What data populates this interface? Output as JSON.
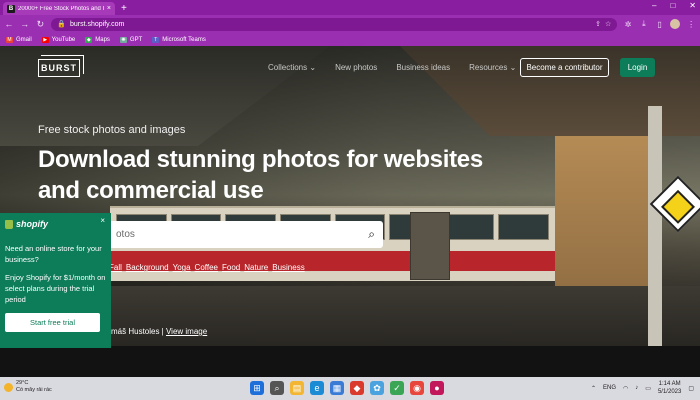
{
  "browser": {
    "tab_title": "20000+ Free Stock Photos and Im...",
    "tab_favicon": "B",
    "new_tab": "+",
    "url": "burst.shopify.com",
    "bookmarks": [
      {
        "label": "Gmail",
        "color": "#ea4335"
      },
      {
        "label": "YouTube",
        "color": "#ff0000"
      },
      {
        "label": "Maps",
        "color": "#34a853"
      },
      {
        "label": "GPT",
        "color": "#74aa9c"
      },
      {
        "label": "Microsoft Teams",
        "color": "#5b5fc7"
      }
    ]
  },
  "site": {
    "logo": "BURST",
    "nav": [
      "Collections ⌄",
      "New photos",
      "Business ideas",
      "Resources ⌄"
    ],
    "contributor_button": "Become a contributor",
    "login_button": "Login",
    "eyebrow": "Free stock photos and images",
    "headline": "Download stunning photos for websites and commercial use",
    "search_placeholder_visible": "otos",
    "categories": [
      "Fall",
      "Background",
      "Yoga",
      "Coffee",
      "Food",
      "Nature",
      "Business"
    ],
    "credit_prefix": "máš Hustoles | ",
    "credit_link": "View image"
  },
  "popup": {
    "brand": "shopify",
    "line1": "Need an online store for your business?",
    "line2": "Enjoy Shopify for $1/month on select plans during the trial period",
    "cta": "Start free trial",
    "close": "×"
  },
  "taskbar": {
    "temp": "29°C",
    "weather": "Có mây rải rác",
    "lang": "ENG",
    "time": "1:14 AM",
    "date": "5/1/2023"
  },
  "colors": {
    "tabstrip": "#8a1ea0",
    "shopify_green": "#0c7c59"
  }
}
